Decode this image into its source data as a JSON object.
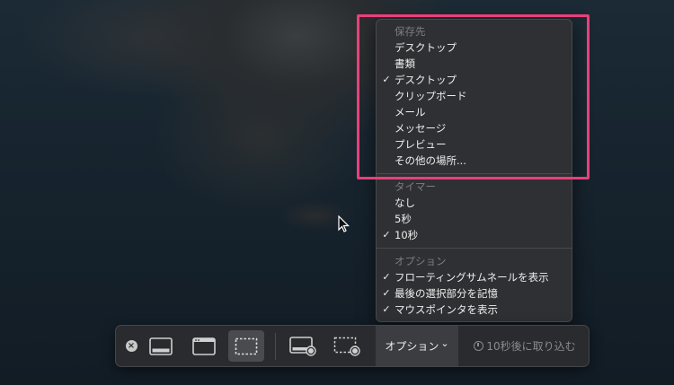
{
  "menu": {
    "save_header": "保存先",
    "save_items": [
      {
        "label": "デスクトップ",
        "checked": false
      },
      {
        "label": "書類",
        "checked": false
      },
      {
        "label": "デスクトップ",
        "checked": true
      },
      {
        "label": "クリップボード",
        "checked": false
      },
      {
        "label": "メール",
        "checked": false
      },
      {
        "label": "メッセージ",
        "checked": false
      },
      {
        "label": "プレビュー",
        "checked": false
      },
      {
        "label": "その他の場所...",
        "checked": false
      }
    ],
    "timer_header": "タイマー",
    "timer_items": [
      {
        "label": "なし",
        "checked": false
      },
      {
        "label": "5秒",
        "checked": false
      },
      {
        "label": "10秒",
        "checked": true
      }
    ],
    "options_header": "オプション",
    "options_items": [
      {
        "label": "フローティングサムネールを表示",
        "checked": true
      },
      {
        "label": "最後の選択部分を記憶",
        "checked": true
      },
      {
        "label": "マウスポインタを表示",
        "checked": true
      }
    ],
    "check_mark": "✓"
  },
  "toolbar": {
    "close_glyph": "×",
    "options_label": "オプション",
    "options_chevron": "⌄",
    "capture_label": "10秒後に取り込む"
  },
  "colors": {
    "highlight": "#e9407a",
    "menu_bg": "#2f3033",
    "toolbar_bg": "#2a2b2e"
  }
}
